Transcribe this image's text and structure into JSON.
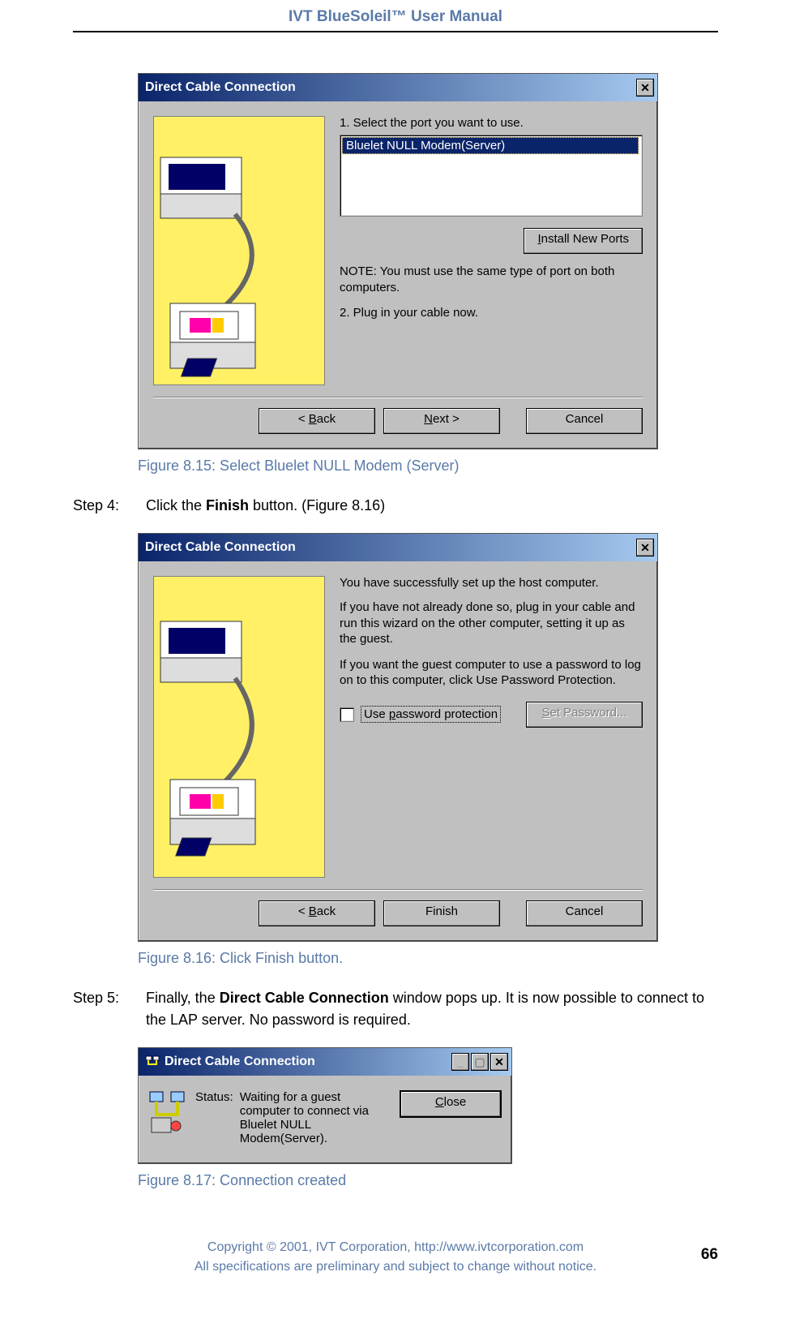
{
  "doc": {
    "header": "IVT BlueSoleil™ User Manual",
    "page_number": "66",
    "copyright_line1": "Copyright © 2001, IVT Corporation, http://www.ivtcorporation.com",
    "copyright_line2": "All specifications are preliminary and subject to change without notice."
  },
  "fig815": {
    "title": "Direct Cable Connection",
    "step1_label": "1. Select the port you want to use.",
    "selected_port": "Bluelet NULL Modem(Server)",
    "install_btn_pre": "I",
    "install_btn_rest": "nstall New Ports",
    "note": "NOTE: You must use the same type of port on both computers.",
    "step2_label": "2. Plug in your cable now.",
    "back_pre": "< ",
    "back_u": "B",
    "back_rest": "ack",
    "next_u": "N",
    "next_rest": "ext >",
    "cancel": "Cancel",
    "caption": "Figure 8.15: Select Bluelet NULL Modem (Server)"
  },
  "step4": {
    "label": "Step 4:",
    "text_pre": "Click the ",
    "text_bold": "Finish",
    "text_post": " button. (Figure 8.16)"
  },
  "fig816": {
    "title": "Direct Cable Connection",
    "line1": "You have successfully set up the host computer.",
    "line2": "If you have not already done so, plug in your cable and run this wizard on the other computer, setting it up as the guest.",
    "line3": "If you want the guest computer to use a password to log on to this computer, click Use Password Protection.",
    "chk_pre": "Use ",
    "chk_u": "p",
    "chk_rest": "assword protection",
    "set_pwd_u": "S",
    "set_pwd_rest": "et Password...",
    "back_pre": "< ",
    "back_u": "B",
    "back_rest": "ack",
    "finish": "Finish",
    "cancel": "Cancel",
    "caption": "Figure 8.16: Click Finish button."
  },
  "step5": {
    "label": "Step 5:",
    "text_pre": "Finally, the ",
    "text_bold": "Direct Cable Connection",
    "text_post": " window pops up. It is now possible to connect to the LAP server. No password is required."
  },
  "fig817": {
    "title": "Direct Cable Connection",
    "status_label": "Status:",
    "status_text": "Waiting for a guest computer to connect via Bluelet NULL Modem(Server).",
    "close_u": "C",
    "close_rest": "lose",
    "caption": "Figure 8.17: Connection created"
  }
}
